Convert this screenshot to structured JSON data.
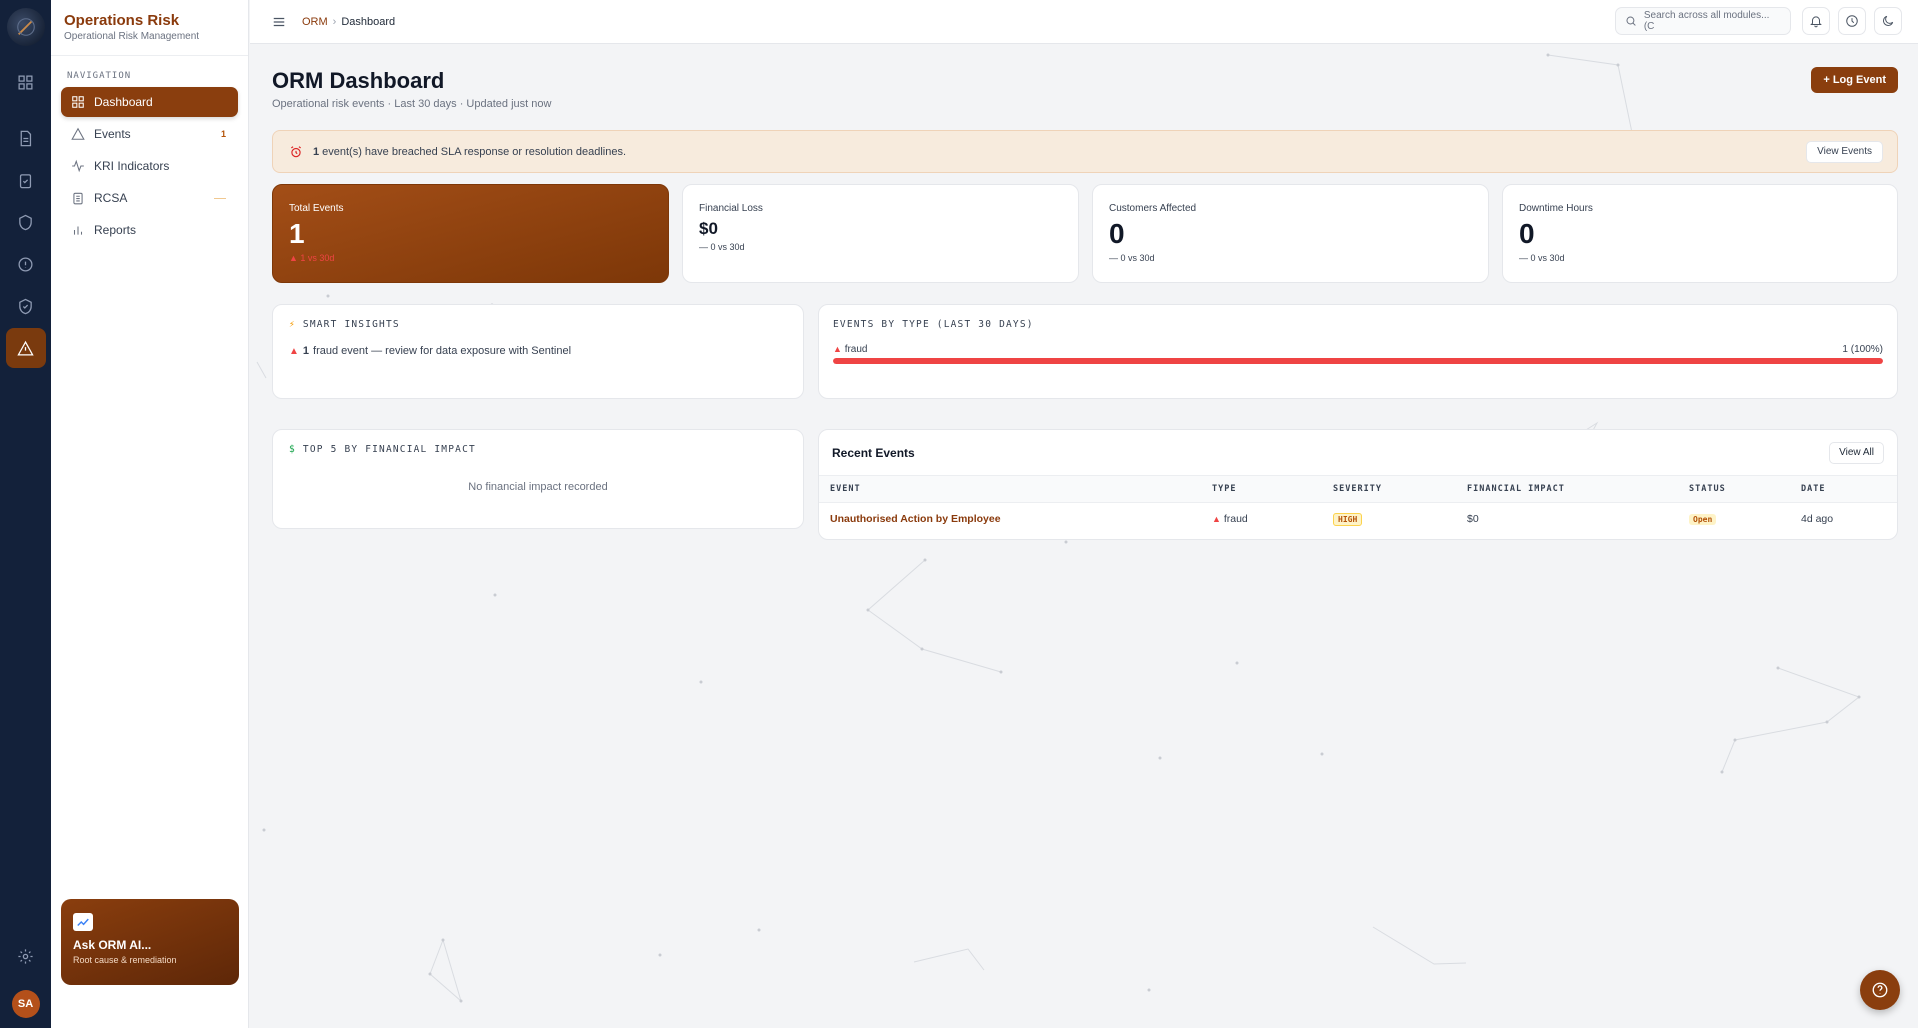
{
  "brand": {
    "title": "Operations Risk",
    "subtitle": "Operational Risk Management"
  },
  "sidebar": {
    "section_label": "NAVIGATION",
    "items": [
      {
        "label": "Dashboard",
        "icon": "grid-icon",
        "active": true,
        "badge": ""
      },
      {
        "label": "Events",
        "icon": "alert-triangle-icon",
        "badge": "1"
      },
      {
        "label": "KRI Indicators",
        "icon": "activity-icon",
        "badge": ""
      },
      {
        "label": "RCSA",
        "icon": "clipboard-icon",
        "badge": ""
      },
      {
        "label": "Reports",
        "icon": "bar-chart-icon",
        "badge": ""
      }
    ],
    "ai_card": {
      "title": "Ask ORM AI...",
      "subtitle": "Root cause & remediation"
    }
  },
  "rail": {
    "avatar_initials": "SA"
  },
  "topbar": {
    "breadcrumb": [
      "ORM",
      "Dashboard"
    ],
    "search_placeholder": "Search across all modules... (C"
  },
  "page": {
    "title": "ORM Dashboard",
    "subtitle": "Operational risk events · Last 30 days · Updated just now",
    "log_button": "+ Log Event"
  },
  "alert": {
    "count": "1",
    "text": "event(s) have breached SLA response or resolution deadlines.",
    "button": "View Events"
  },
  "kpis": [
    {
      "label": "Total Events",
      "value": "1",
      "delta": "▲ 1 vs 30d"
    },
    {
      "label": "Financial Loss",
      "value": "$0",
      "delta": "— 0 vs 30d"
    },
    {
      "label": "Customers Affected",
      "value": "0",
      "delta": "— 0 vs 30d"
    },
    {
      "label": "Downtime Hours",
      "value": "0",
      "delta": "— 0 vs 30d"
    }
  ],
  "insights": {
    "title": "SMART INSIGHTS",
    "items": [
      {
        "count": "1",
        "text": "fraud event — review for data exposure with Sentinel"
      }
    ]
  },
  "events_by_type": {
    "title": "EVENTS BY TYPE (LAST 30 DAYS)",
    "rows": [
      {
        "type": "fraud",
        "count_label": "1 (100%)",
        "fraction": 1.0
      }
    ]
  },
  "top5": {
    "title": "TOP 5 BY FINANCIAL IMPACT",
    "empty": "No financial impact recorded"
  },
  "recent_events": {
    "title": "Recent Events",
    "button": "View All",
    "columns": [
      "EVENT",
      "TYPE",
      "SEVERITY",
      "FINANCIAL IMPACT",
      "STATUS",
      "DATE"
    ],
    "rows": [
      {
        "event": "Unauthorised Action by Employee",
        "type": "fraud",
        "severity": "HIGH",
        "impact": "$0",
        "status": "Open",
        "date": "4d ago"
      }
    ]
  },
  "colors": {
    "brand": "#8a3e0e",
    "rail": "#13213a",
    "danger": "#ef4444"
  }
}
